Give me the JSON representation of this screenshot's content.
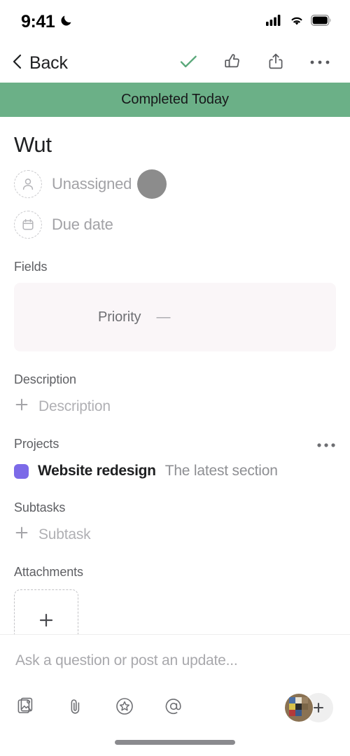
{
  "status_bar": {
    "time": "9:41",
    "dnd_icon": "crescent-moon-icon",
    "signal_icon": "cellular-signal-icon",
    "wifi_icon": "wifi-icon",
    "battery_icon": "battery-full-icon"
  },
  "nav_bar": {
    "back_label": "Back",
    "back_icon": "chevron-left-icon",
    "actions": [
      {
        "name": "complete-task-button",
        "icon": "checkmark-icon",
        "color": "#5aa87a"
      },
      {
        "name": "like-button",
        "icon": "thumbs-up-icon",
        "color": "#58595d"
      },
      {
        "name": "share-button",
        "icon": "share-icon",
        "color": "#58595d"
      },
      {
        "name": "more-options-button",
        "icon": "ellipsis-icon",
        "color": "#58595d"
      }
    ]
  },
  "banner": {
    "text": "Completed Today",
    "color": "#6bb087"
  },
  "task": {
    "title": "Wut",
    "assignee": {
      "label": "Unassigned",
      "icon": "person-icon"
    },
    "due_date": {
      "label": "Due date",
      "icon": "calendar-icon"
    }
  },
  "fields": {
    "heading": "Fields",
    "card_color": "#faf6f8",
    "rows": [
      {
        "name": "Priority",
        "value": "—"
      }
    ]
  },
  "description": {
    "heading": "Description",
    "add_label": "Description",
    "add_icon": "plus-icon"
  },
  "projects": {
    "heading": "Projects",
    "menu_icon": "ellipsis-icon",
    "items": [
      {
        "name": "Website redesign",
        "section": "The latest section",
        "color": "#7c6ae8"
      }
    ]
  },
  "subtasks": {
    "heading": "Subtasks",
    "add_label": "Subtask",
    "add_icon": "plus-icon"
  },
  "attachments": {
    "heading": "Attachments",
    "add_icon": "plus-icon"
  },
  "composer": {
    "placeholder": "Ask a question or post an update...",
    "tools": [
      {
        "name": "image-picker-button",
        "icon": "photo-stack-icon"
      },
      {
        "name": "attach-file-button",
        "icon": "paperclip-icon"
      },
      {
        "name": "sticker-button",
        "icon": "star-circle-icon"
      },
      {
        "name": "mention-button",
        "icon": "at-mention-icon"
      }
    ],
    "add_collaborator_icon": "plus-icon",
    "avatar_icon": "user-avatar"
  },
  "overlay": {
    "tap_indicator": "touch-indicator-dot"
  },
  "home_indicator": "home-indicator-bar"
}
